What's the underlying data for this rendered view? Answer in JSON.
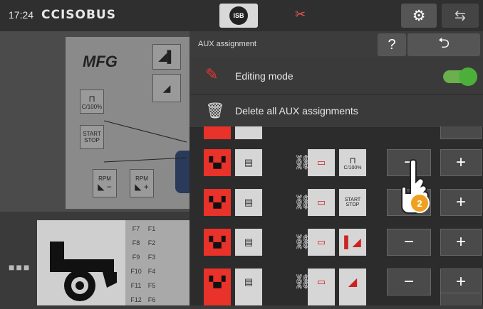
{
  "topbar": {
    "time": "17:24",
    "brand": "CCISOBUS",
    "isb_label": "ISB",
    "settings_icon": "gear-icon",
    "swap_icon": "screen-swap-icon"
  },
  "mask": {
    "title": "MFG",
    "btn_cutoff": "C/100%",
    "btn_start": "START",
    "btn_stop": "STOP",
    "btn_rpm_minus": "RPM",
    "btn_rpm_plus": "RPM",
    "fkeys": [
      "F7",
      "F1",
      "F8",
      "F2",
      "F9",
      "F3",
      "F10",
      "F4",
      "F11",
      "F5",
      "F12",
      "F6"
    ]
  },
  "aux": {
    "title": "AUX assignment",
    "help": "?",
    "editing_mode": "Editing mode",
    "editing_mode_on": true,
    "delete_all": "Delete all AUX assignments",
    "rows": [
      {
        "fn2": "C/100%"
      },
      {
        "fn2": "START STOP"
      },
      {
        "fn2": ""
      },
      {
        "fn2": ""
      }
    ],
    "step_badge": "2"
  },
  "colors": {
    "accent_red": "#e8322a",
    "toggle_green": "#4caf3a",
    "badge_orange": "#f0a020"
  }
}
